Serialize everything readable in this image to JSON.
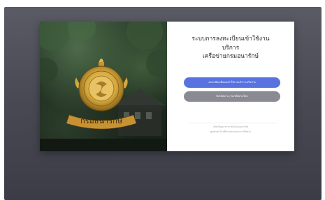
{
  "login": {
    "title_lines": [
      "ระบบการลงทะเบียนเข้าใช้งาน",
      "บริการ",
      "เครือข่ายกรมอนารักษ์"
    ],
    "primary_button": "ลงทะเบียนเพื่อขอเข้าใช้งานบริการเครือข่าย",
    "secondary_button": "ลืมรหัสผ่าน / ขอรหัสผ่านใหม่",
    "footer_lines": [
      "สำหรับบุคลากรภายในกรมอนารักษ์",
      "ศูนย์เทคโนโลยีสารสนเทศและการสื่อสาร"
    ]
  },
  "emblem": {
    "text": "กรมธนารักษ์",
    "colors": {
      "gold": "#d6a93e",
      "gold_dark": "#8a6418",
      "ring": "#c79233"
    }
  },
  "colors": {
    "background_top": "#5b5b66",
    "background_bottom": "#3c3c47",
    "primary": "#5872e0",
    "secondary": "#8a8a92"
  }
}
